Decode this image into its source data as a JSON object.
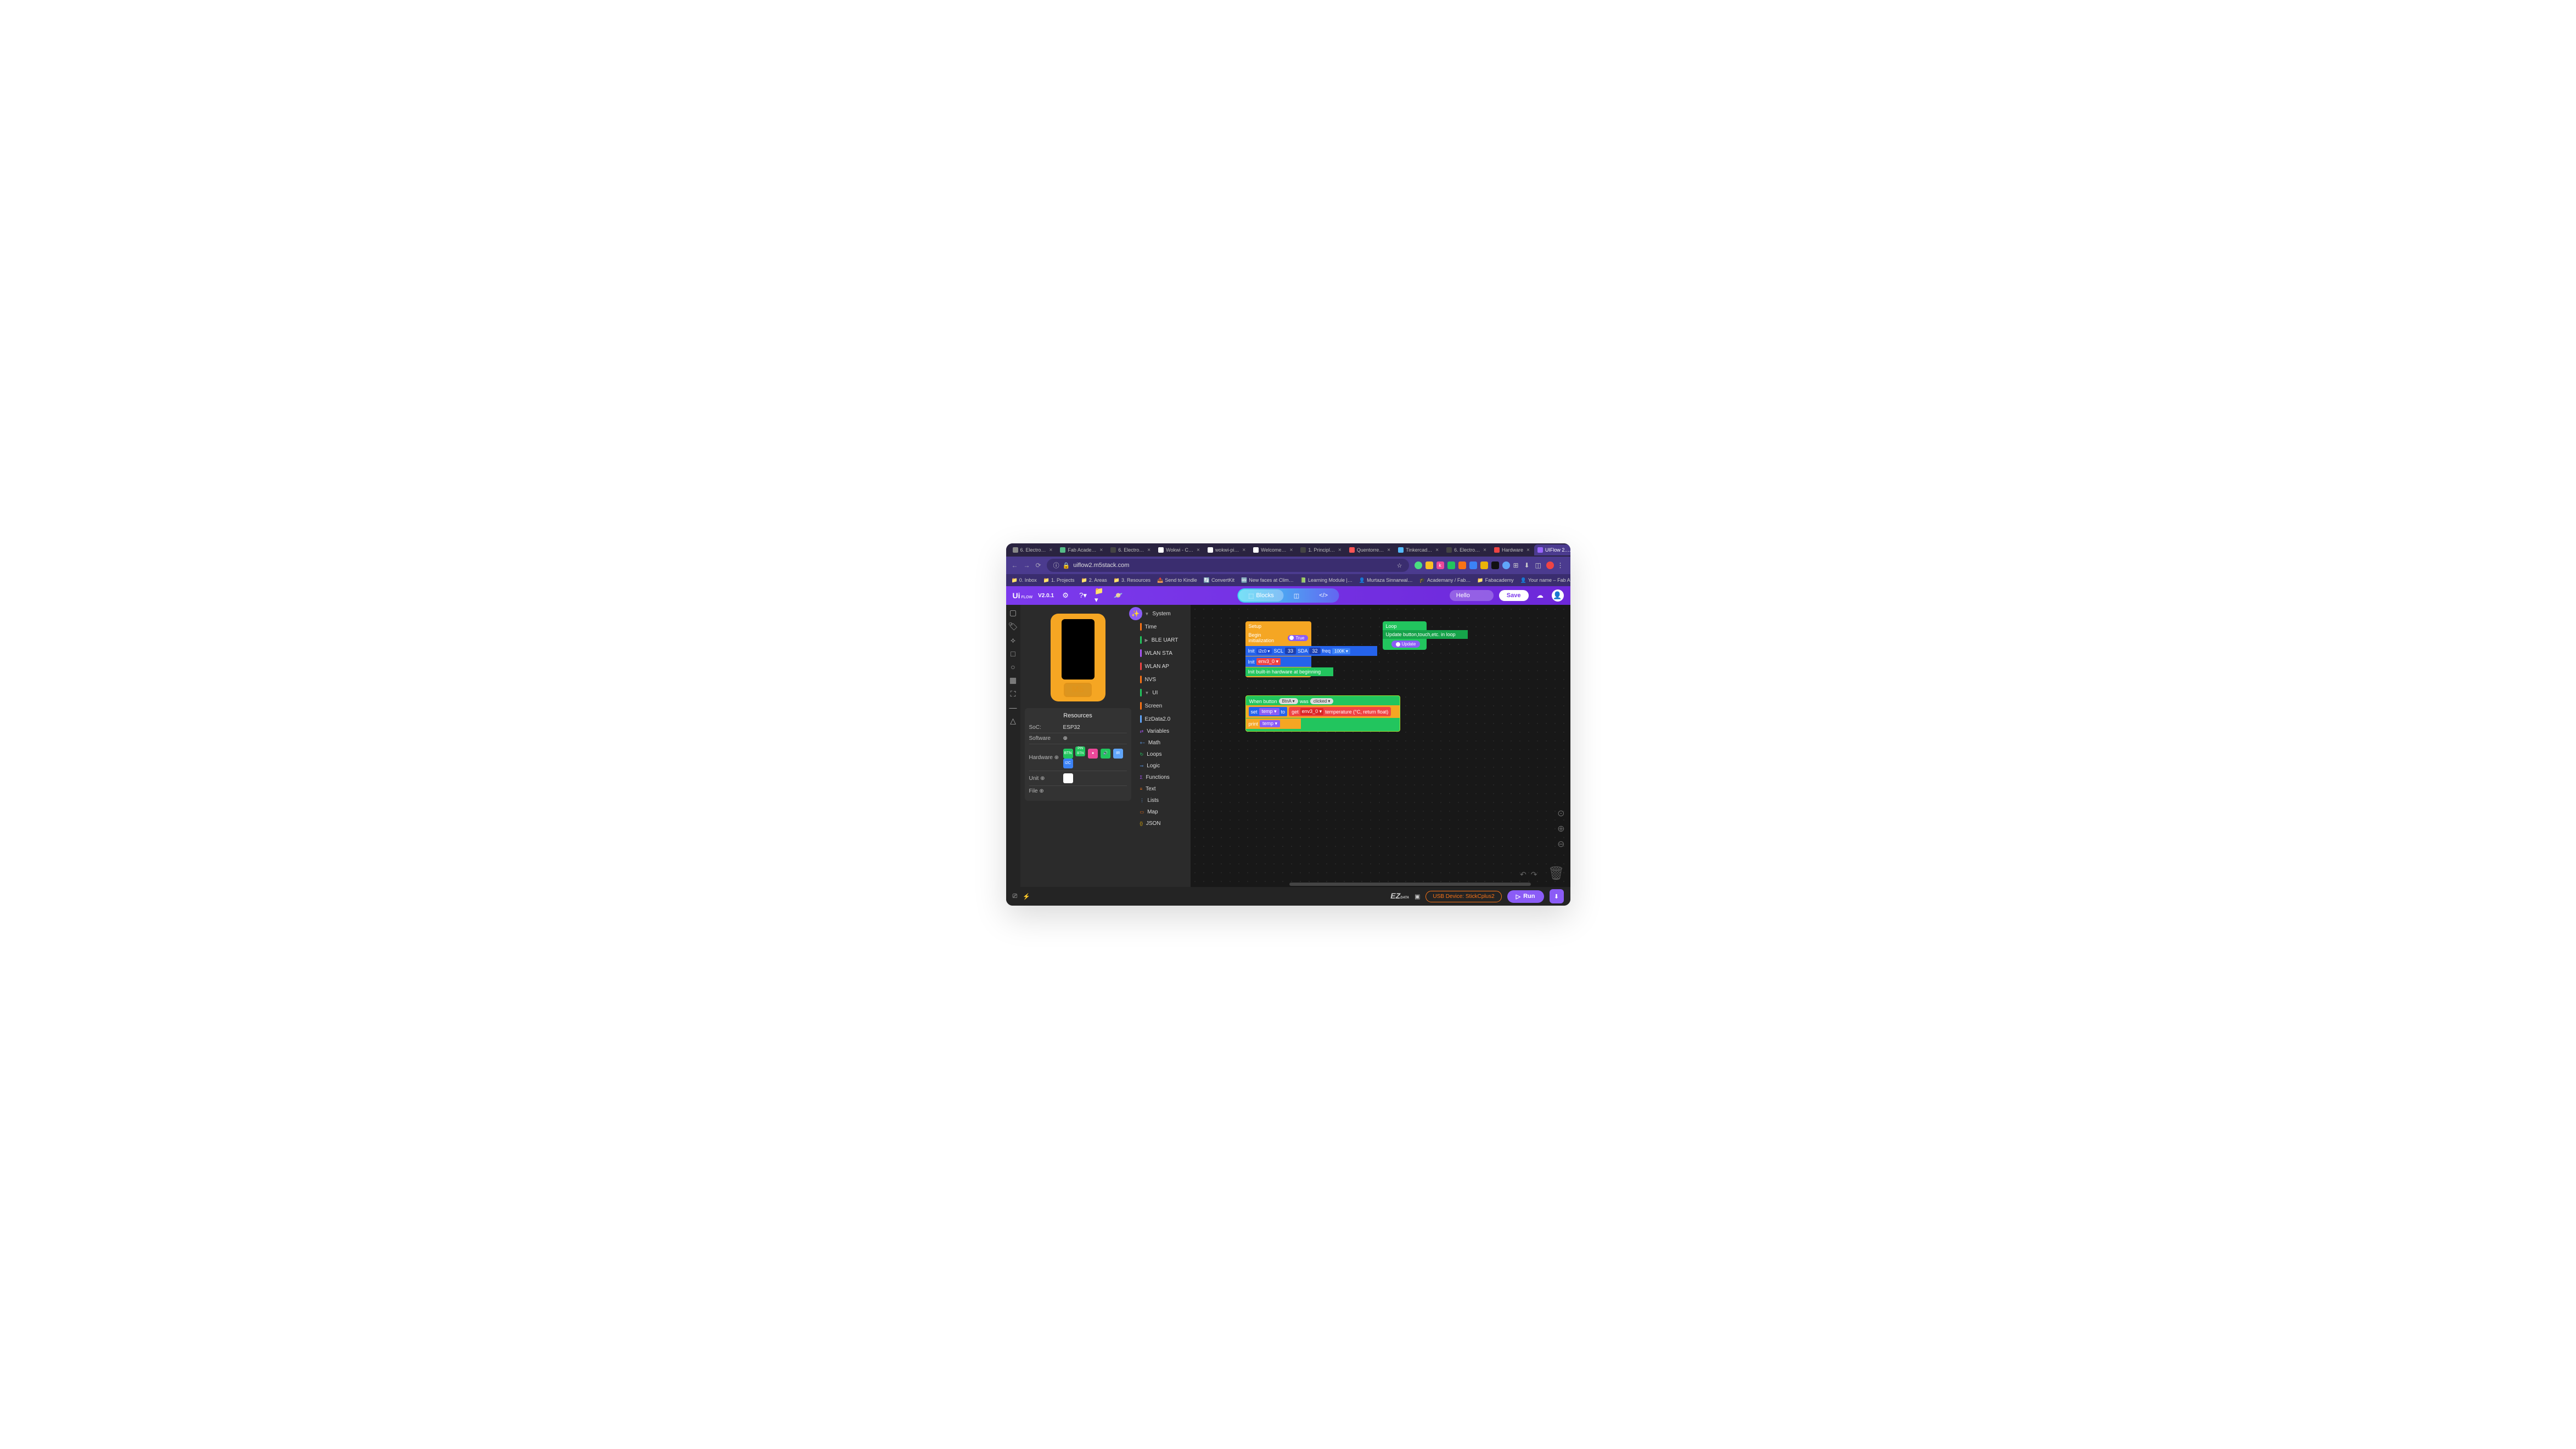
{
  "browser": {
    "tabs": [
      {
        "label": "6. Electro…",
        "fav": "#888"
      },
      {
        "label": "Fab Acade…",
        "fav": "#5b8"
      },
      {
        "label": "6. Electro…",
        "fav": "#444"
      },
      {
        "label": "Wokwi - C…",
        "fav": "#fff"
      },
      {
        "label": "wokwi-pi…",
        "fav": "#fff"
      },
      {
        "label": "Welcome…",
        "fav": "#fff"
      },
      {
        "label": "1. Principl…",
        "fav": "#444"
      },
      {
        "label": "Quentorre…",
        "fav": "#f55"
      },
      {
        "label": "Tinkercad…",
        "fav": "#5bf"
      },
      {
        "label": "6. Electro…",
        "fav": "#444"
      },
      {
        "label": "Hardware",
        "fav": "#e44"
      },
      {
        "label": "UIFlow 2.…",
        "fav": "#96f",
        "active": true
      }
    ],
    "url": "uiflow2.m5stack.com",
    "bookmarks": [
      {
        "icon": "📁",
        "label": "0. Inbox"
      },
      {
        "icon": "📁",
        "label": "1. Projects"
      },
      {
        "icon": "📁",
        "label": "2. Areas"
      },
      {
        "icon": "📁",
        "label": "3. Resources"
      },
      {
        "icon": "📤",
        "label": "Send to Kindle"
      },
      {
        "icon": "🔄",
        "label": "ConvertKit"
      },
      {
        "icon": "🆕",
        "label": "New faces at Clim…"
      },
      {
        "icon": "📗",
        "label": "Learning Module |…"
      },
      {
        "icon": "👤",
        "label": "Murtaza Sinnarwal…"
      },
      {
        "icon": "🎓",
        "label": "Academany / Fab…"
      },
      {
        "icon": "📁",
        "label": "Fabacademy"
      },
      {
        "icon": "👤",
        "label": "Your name – Fab A…"
      }
    ]
  },
  "app": {
    "logo": "Ui",
    "logosub": "FLOW",
    "version": "V2.0.1",
    "tabs": {
      "blocks": "Blocks"
    },
    "project_name": "Hello",
    "save": "Save"
  },
  "resources": {
    "title": "Resources",
    "soc_label": "SoC:",
    "soc": "ESP32",
    "software_label": "Software",
    "hardware_label": "Hardware",
    "hw_chips": [
      {
        "t": "BTN",
        "c": "#22c55e"
      },
      {
        "t": "PIN BTN",
        "c": "#22c55e"
      },
      {
        "t": "●",
        "c": "#ec4899"
      },
      {
        "t": "🔊",
        "c": "#22c55e"
      },
      {
        "t": "IR",
        "c": "#60a5fa"
      },
      {
        "t": "I2C",
        "c": "#3b82f6"
      }
    ],
    "unit_label": "Unit",
    "file_label": "File",
    "m5": "M5"
  },
  "toolbox": [
    {
      "name": "System",
      "c": "#22c55e",
      "arr": "▼"
    },
    {
      "name": "Time",
      "c": "#f97316"
    },
    {
      "name": "BLE UART",
      "c": "#22c55e",
      "arr": "▶"
    },
    {
      "name": "WLAN STA",
      "c": "#a855f7"
    },
    {
      "name": "WLAN AP",
      "c": "#ef4444"
    },
    {
      "name": "NVS",
      "c": "#f97316"
    },
    {
      "name": "UI",
      "c": "#22c55e",
      "arr": "▼"
    },
    {
      "name": "Screen",
      "c": "#f97316"
    },
    {
      "name": "EzData2.0",
      "c": "#60a5fa"
    },
    {
      "name": "Variables",
      "c": "#a855f7",
      "icon": "⇄"
    },
    {
      "name": "Math",
      "c": "#60a5fa",
      "icon": "+−"
    },
    {
      "name": "Loops",
      "c": "#22c55e",
      "icon": "↻"
    },
    {
      "name": "Logic",
      "c": "#60a5fa",
      "icon": "⊸"
    },
    {
      "name": "Functions",
      "c": "#a855f7",
      "icon": "Σ"
    },
    {
      "name": "Text",
      "c": "#f97316",
      "icon": "≡"
    },
    {
      "name": "Lists",
      "c": "#60a5fa",
      "icon": "⋮"
    },
    {
      "name": "Map",
      "c": "#f97316",
      "icon": "▭"
    },
    {
      "name": "JSON",
      "c": "#eab308",
      "icon": "{}"
    }
  ],
  "blocks": {
    "setup": {
      "title": "Setup",
      "begin": "Begin initialization",
      "true": "True",
      "init": "Init",
      "i2c": "i2c0 ▾",
      "scl": "SCL",
      "scl_n": "33",
      "sda": "SDA",
      "sda_n": "32",
      "freq": "freq",
      "freq_v": "100K ▾",
      "init2": "Init",
      "env": "env3_0 ▾",
      "hw": "Init built-in hardware at beginning"
    },
    "loop": {
      "title": "Loop",
      "body": "Update button,touch,etc. in loop",
      "update": "Update"
    },
    "event": {
      "when": "When button",
      "btn": "BtnA ▾",
      "was": "was",
      "clicked": "clicked ▾",
      "set": "set",
      "var": "temp ▾",
      "to": "to",
      "get": "get",
      "envg": "env3_0 ▾",
      "temptxt": "temperature (°C, return float)",
      "print": "print",
      "pvar": "temp ▾"
    }
  },
  "footer": {
    "ez": "EZ",
    "ezs": "DATA",
    "usb": "USB Device: StickCplus2",
    "run": "Run"
  }
}
